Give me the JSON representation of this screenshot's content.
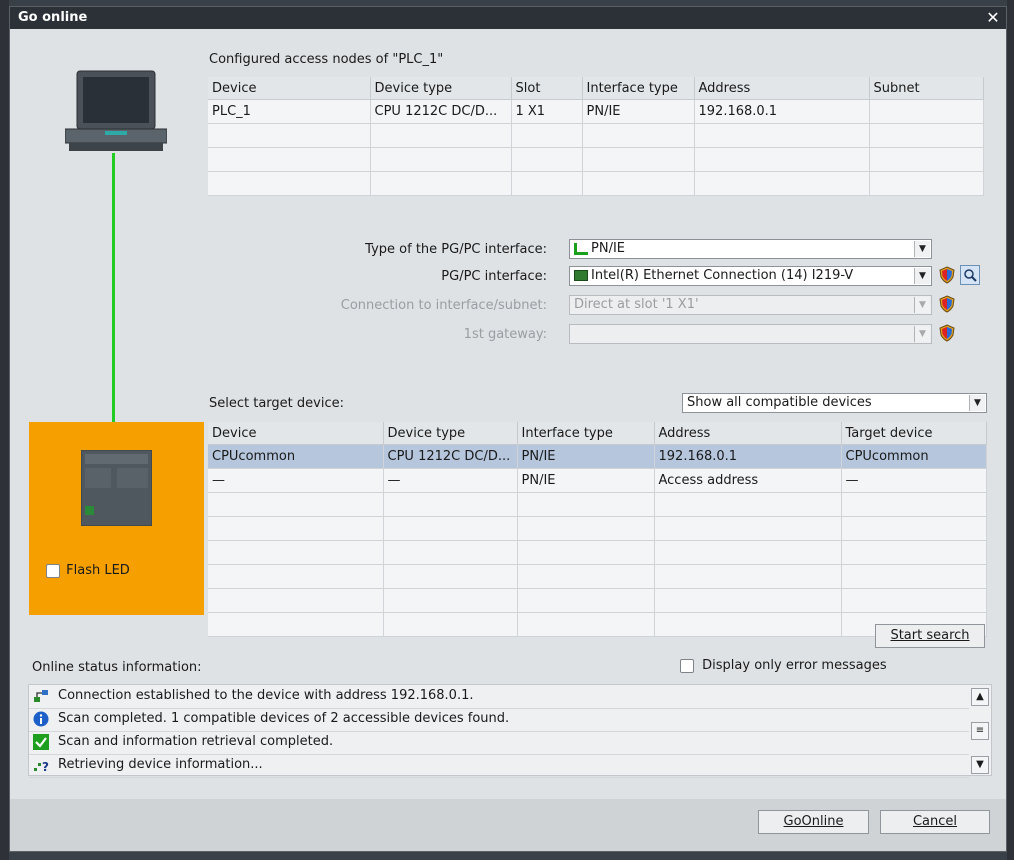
{
  "dialog": {
    "title": "Go online",
    "close_label": "✕"
  },
  "configured": {
    "heading": "Configured access nodes of \"PLC_1\"",
    "columns": [
      "Device",
      "Device type",
      "Slot",
      "Interface type",
      "Address",
      "Subnet"
    ],
    "rows": [
      [
        "PLC_1",
        "CPU 1212C DC/D...",
        "1 X1",
        "PN/IE",
        "192.168.0.1",
        ""
      ]
    ]
  },
  "interface": {
    "type_label": "Type of the PG/PC interface:",
    "type_value": "PN/IE",
    "pgpc_label": "PG/PC interface:",
    "pgpc_value": "Intel(R) Ethernet Connection (14) I219-V",
    "conn_label": "Connection to interface/subnet:",
    "conn_value": "Direct at slot '1 X1'",
    "gateway_label": "1st gateway:",
    "gateway_value": ""
  },
  "target": {
    "heading": "Select target device:",
    "filter_value": "Show all compatible devices",
    "columns": [
      "Device",
      "Device type",
      "Interface type",
      "Address",
      "Target device"
    ],
    "rows": [
      [
        "CPUcommon",
        "CPU 1212C DC/D...",
        "PN/IE",
        "192.168.0.1",
        "CPUcommon"
      ],
      [
        "—",
        "—",
        "PN/IE",
        "Access address",
        "—"
      ]
    ],
    "flash_led_label": "Flash LED",
    "start_search_label": "Start search"
  },
  "status": {
    "heading": "Online status information:",
    "error_only_label": "Display only error messages",
    "messages": [
      {
        "icon": "connection-icon",
        "text": "Connection established to the device with address 192.168.0.1."
      },
      {
        "icon": "info-icon",
        "text": "Scan completed. 1 compatible devices of 2 accessible devices found."
      },
      {
        "icon": "check-icon",
        "text": "Scan and information retrieval completed."
      },
      {
        "icon": "retrieving-icon",
        "text": "Retrieving device information..."
      }
    ]
  },
  "buttons": {
    "go_online": "GoOnline",
    "cancel": "Cancel"
  },
  "colors": {
    "accent_orange": "#f5a000",
    "link_green": "#22cc22",
    "selected_row": "#b5c6dd"
  }
}
